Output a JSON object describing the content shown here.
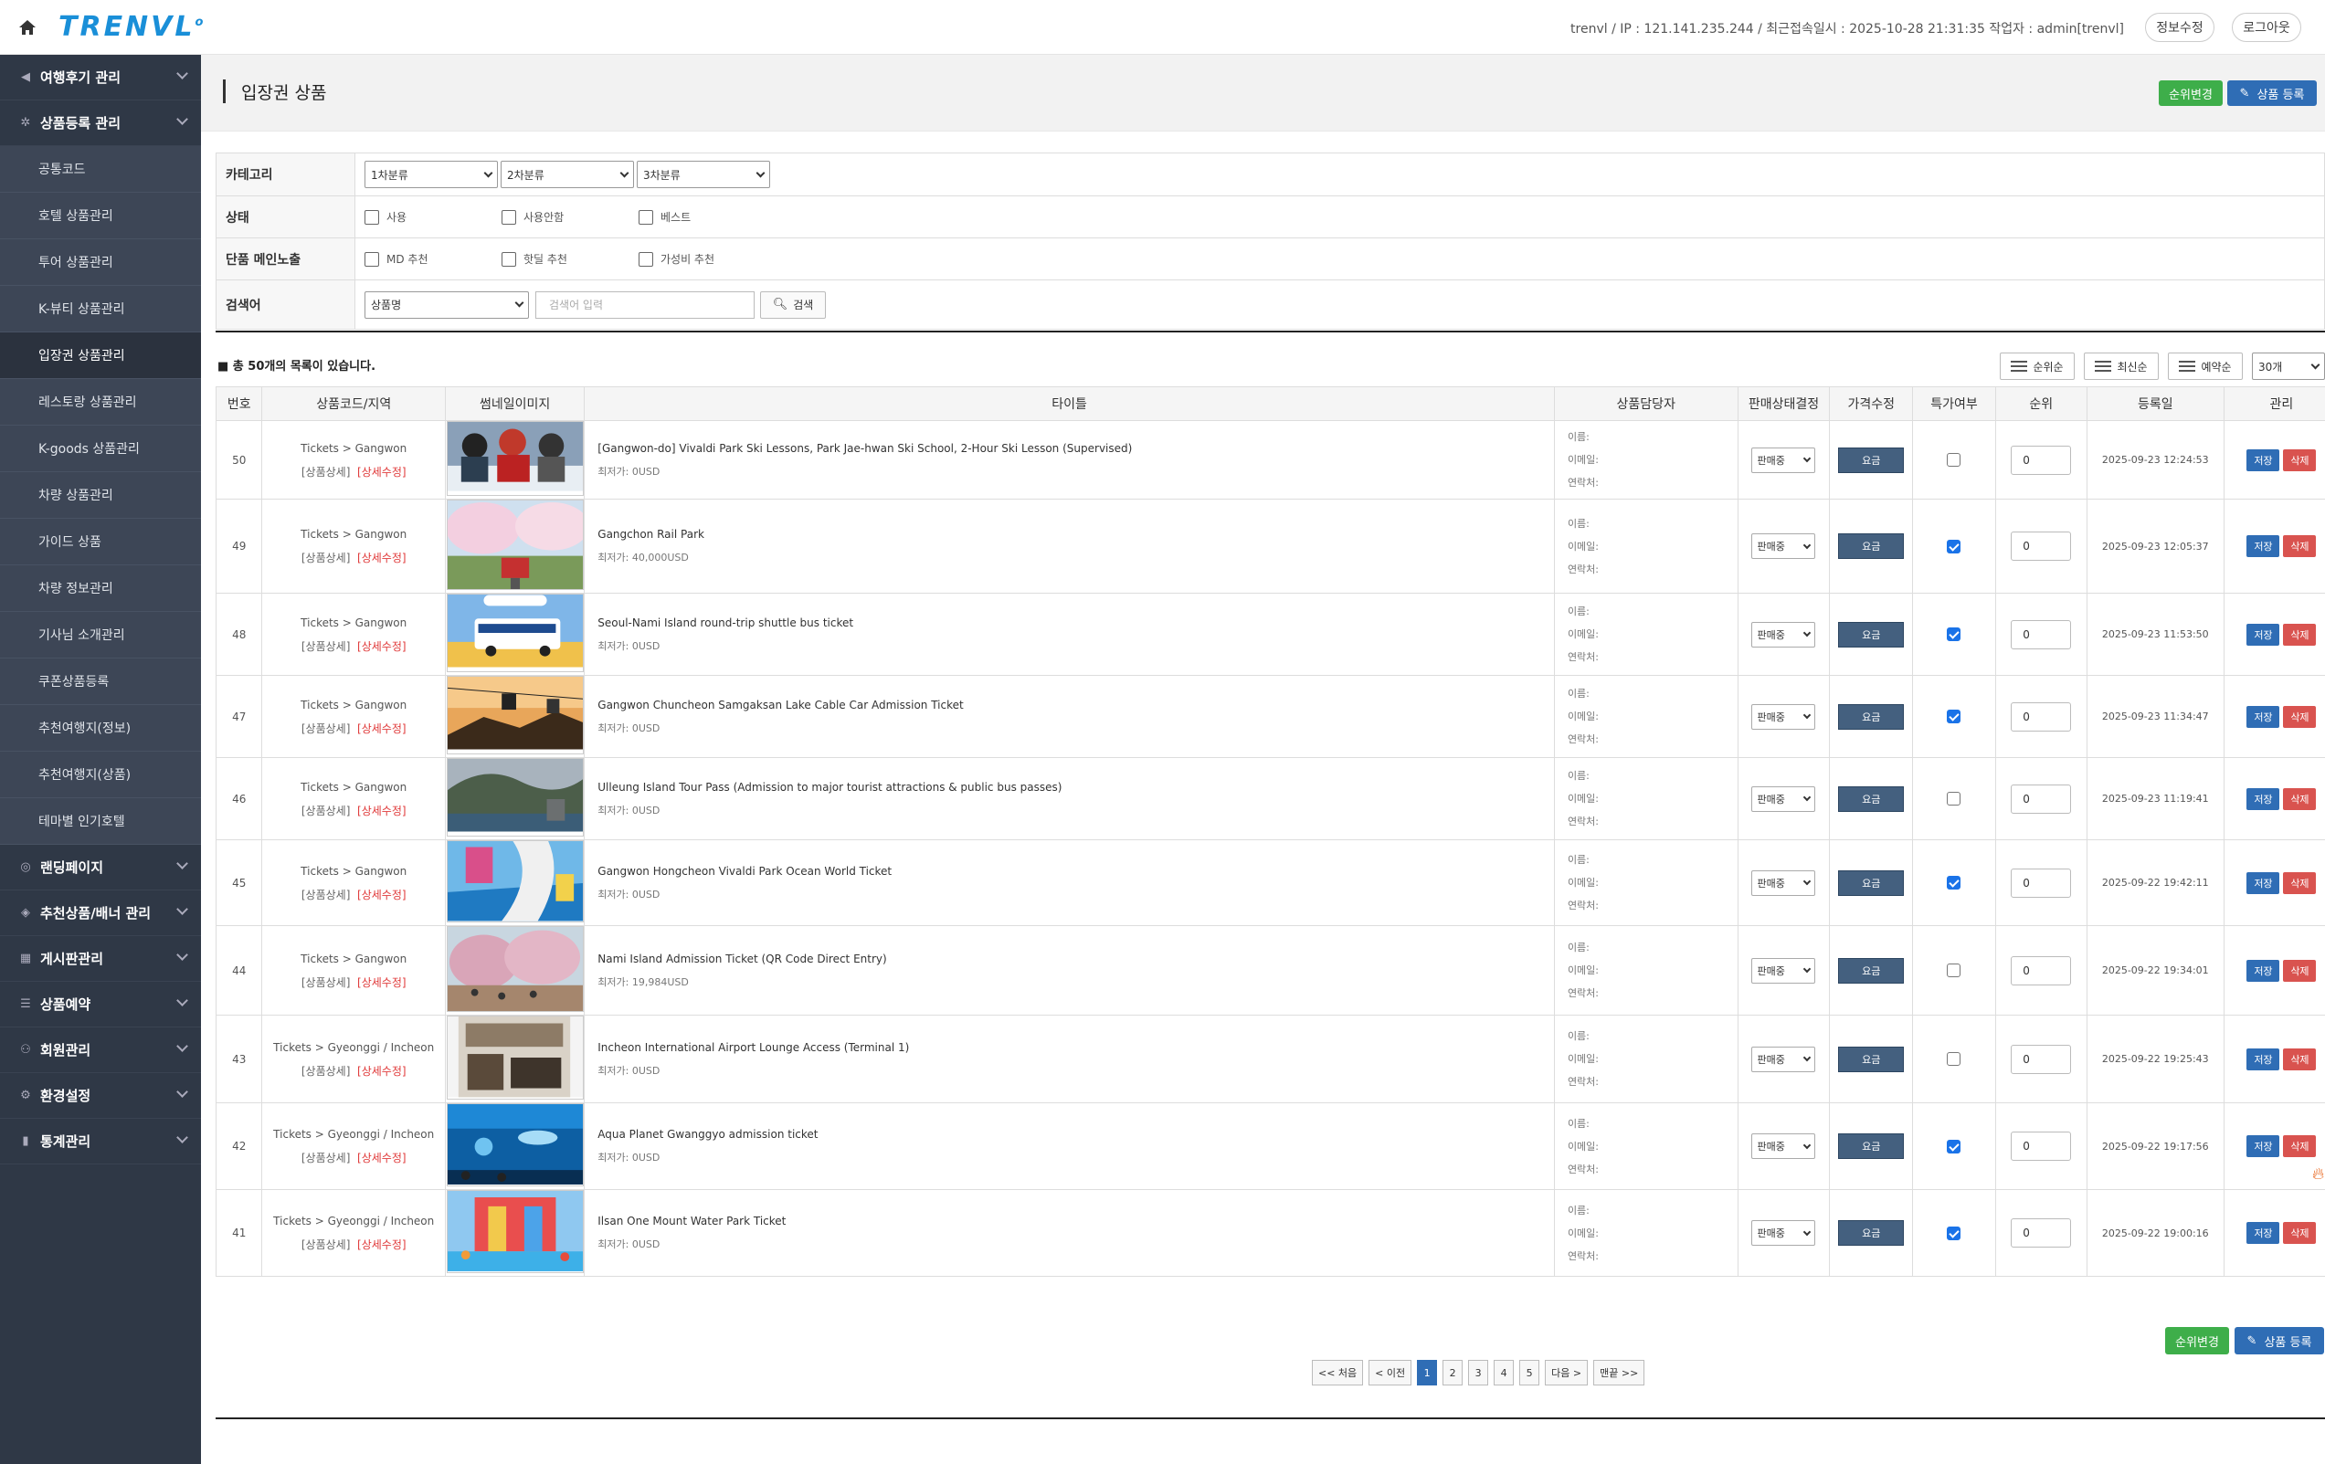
{
  "header": {
    "logo": "TRENVL",
    "info": "trenvl / IP : 121.141.235.244 / 최근접속일시 : 2025-10-28 21:31:35 작업자 : admin[trenvl]",
    "edit_info": "정보수정",
    "logout": "로그아웃"
  },
  "sidebar": {
    "groups_top": [
      {
        "label": "여행후기 관리",
        "icon": "megaphone-icon"
      },
      {
        "label": "상품등록 관리",
        "icon": "hiker-icon"
      }
    ],
    "sub_items": [
      "공통코드",
      "호텔 상품관리",
      "투어 상품관리",
      "K-뷰티 상품관리",
      "입장권 상품관리",
      "레스토랑 상품관리",
      "K-goods 상품관리",
      "차량 상품관리",
      "가이드 상품",
      "차량 정보관리",
      "기사님 소개관리",
      "쿠폰상품등록",
      "추천여행지(정보)",
      "추천여행지(상품)",
      "테마별 인기호텔"
    ],
    "groups_bottom": [
      {
        "label": "랜딩페이지",
        "icon": "globe-icon"
      },
      {
        "label": "추천상품/배너 관리",
        "icon": "layers-icon"
      },
      {
        "label": "게시판관리",
        "icon": "board-icon"
      },
      {
        "label": "상품예약",
        "icon": "list-icon"
      },
      {
        "label": "회원관리",
        "icon": "members-icon"
      },
      {
        "label": "환경설정",
        "icon": "gear-icon"
      },
      {
        "label": "통계관리",
        "icon": "chart-icon"
      }
    ]
  },
  "page": {
    "title": "입장권 상품",
    "rank_change": "순위변경",
    "register": "상품 등록"
  },
  "filter": {
    "category_label": "카테고리",
    "cat1": "1차분류",
    "cat2": "2차분류",
    "cat3": "3차분류",
    "status_label": "상태",
    "status_options": [
      "사용",
      "사용안함",
      "베스트"
    ],
    "main_label": "단품 메인노출",
    "main_options": [
      "MD 추천",
      "핫딜 추천",
      "가성비 추천"
    ],
    "search_label": "검색어",
    "search_field": "상품명",
    "search_placeholder": "검색어 입력",
    "search_btn": "검색"
  },
  "list": {
    "count_text": "■ 총 50개의 목록이 있습니다.",
    "sort": [
      "순위순",
      "최신순",
      "예약순"
    ],
    "page_size": "30개",
    "columns": [
      "번호",
      "상품코드/지역",
      "썸네일이미지",
      "타이틀",
      "상품담당자",
      "판매상태결정",
      "가격수정",
      "특가여부",
      "순위",
      "등록일",
      "관리"
    ],
    "detail_link": "[상품상세]",
    "edit_link": "[상세수정]",
    "mgr_name": "이름:",
    "mgr_email": "이메일:",
    "mgr_phone": "연락처:",
    "status_value": "판매중",
    "price_btn": "요금",
    "save": "저장",
    "delete": "삭제",
    "rows": [
      {
        "no": "50",
        "region": "Tickets > Gangwon",
        "title": "[Gangwon-do] Vivaldi Park Ski Lessons, Park Jae-hwan Ski School, 2-Hour Ski Lesson (Supervised)",
        "price": "최저가: 0USD",
        "special": false,
        "rank": "0",
        "date": "2025-09-23 12:24:53",
        "thumb": "ski"
      },
      {
        "no": "49",
        "region": "Tickets > Gangwon",
        "title": "Gangchon Rail Park",
        "price": "최저가: 40,000USD",
        "special": true,
        "rank": "0",
        "date": "2025-09-23 12:05:37",
        "thumb": "rail"
      },
      {
        "no": "48",
        "region": "Tickets > Gangwon",
        "title": "Seoul-Nami Island round-trip shuttle bus ticket",
        "price": "최저가: 0USD",
        "special": true,
        "rank": "0",
        "date": "2025-09-23 11:53:50",
        "thumb": "bus"
      },
      {
        "no": "47",
        "region": "Tickets > Gangwon",
        "title": "Gangwon Chuncheon Samgaksan Lake Cable Car Admission Ticket",
        "price": "최저가: 0USD",
        "special": true,
        "rank": "0",
        "date": "2025-09-23 11:34:47",
        "thumb": "cable"
      },
      {
        "no": "46",
        "region": "Tickets > Gangwon",
        "title": "Ulleung Island Tour Pass (Admission to major tourist attractions & public bus passes)",
        "price": "최저가: 0USD",
        "special": false,
        "rank": "0",
        "date": "2025-09-23 11:19:41",
        "thumb": "island"
      },
      {
        "no": "45",
        "region": "Tickets > Gangwon",
        "title": "Gangwon Hongcheon Vivaldi Park Ocean World Ticket",
        "price": "최저가: 0USD",
        "special": true,
        "rank": "0",
        "date": "2025-09-22 19:42:11",
        "thumb": "water"
      },
      {
        "no": "44",
        "region": "Tickets > Gangwon",
        "title": "Nami Island Admission Ticket (QR Code Direct Entry)",
        "price": "최저가: 19,984USD",
        "special": false,
        "rank": "0",
        "date": "2025-09-22 19:34:01",
        "thumb": "nami"
      },
      {
        "no": "43",
        "region": "Tickets > Gyeonggi / Incheon",
        "title": "Incheon International Airport Lounge Access (Terminal 1)",
        "price": "최저가: 0USD",
        "special": false,
        "rank": "0",
        "date": "2025-09-22 19:25:43",
        "thumb": "lounge"
      },
      {
        "no": "42",
        "region": "Tickets > Gyeonggi / Incheon",
        "title": "Aqua Planet Gwanggyo admission ticket",
        "price": "최저가: 0USD",
        "special": true,
        "rank": "0",
        "date": "2025-09-22 19:17:56",
        "thumb": "aqua"
      },
      {
        "no": "41",
        "region": "Tickets > Gyeonggi / Incheon",
        "title": "Ilsan One Mount Water Park Ticket",
        "price": "최저가: 0USD",
        "special": true,
        "rank": "0",
        "date": "2025-09-22 19:00:16",
        "thumb": "park"
      }
    ]
  },
  "pagination": {
    "first": "<< 처음",
    "prev": "< 이전",
    "pages": [
      "1",
      "2",
      "3",
      "4",
      "5"
    ],
    "next": "다음 >",
    "last": "맨끝 >>"
  }
}
